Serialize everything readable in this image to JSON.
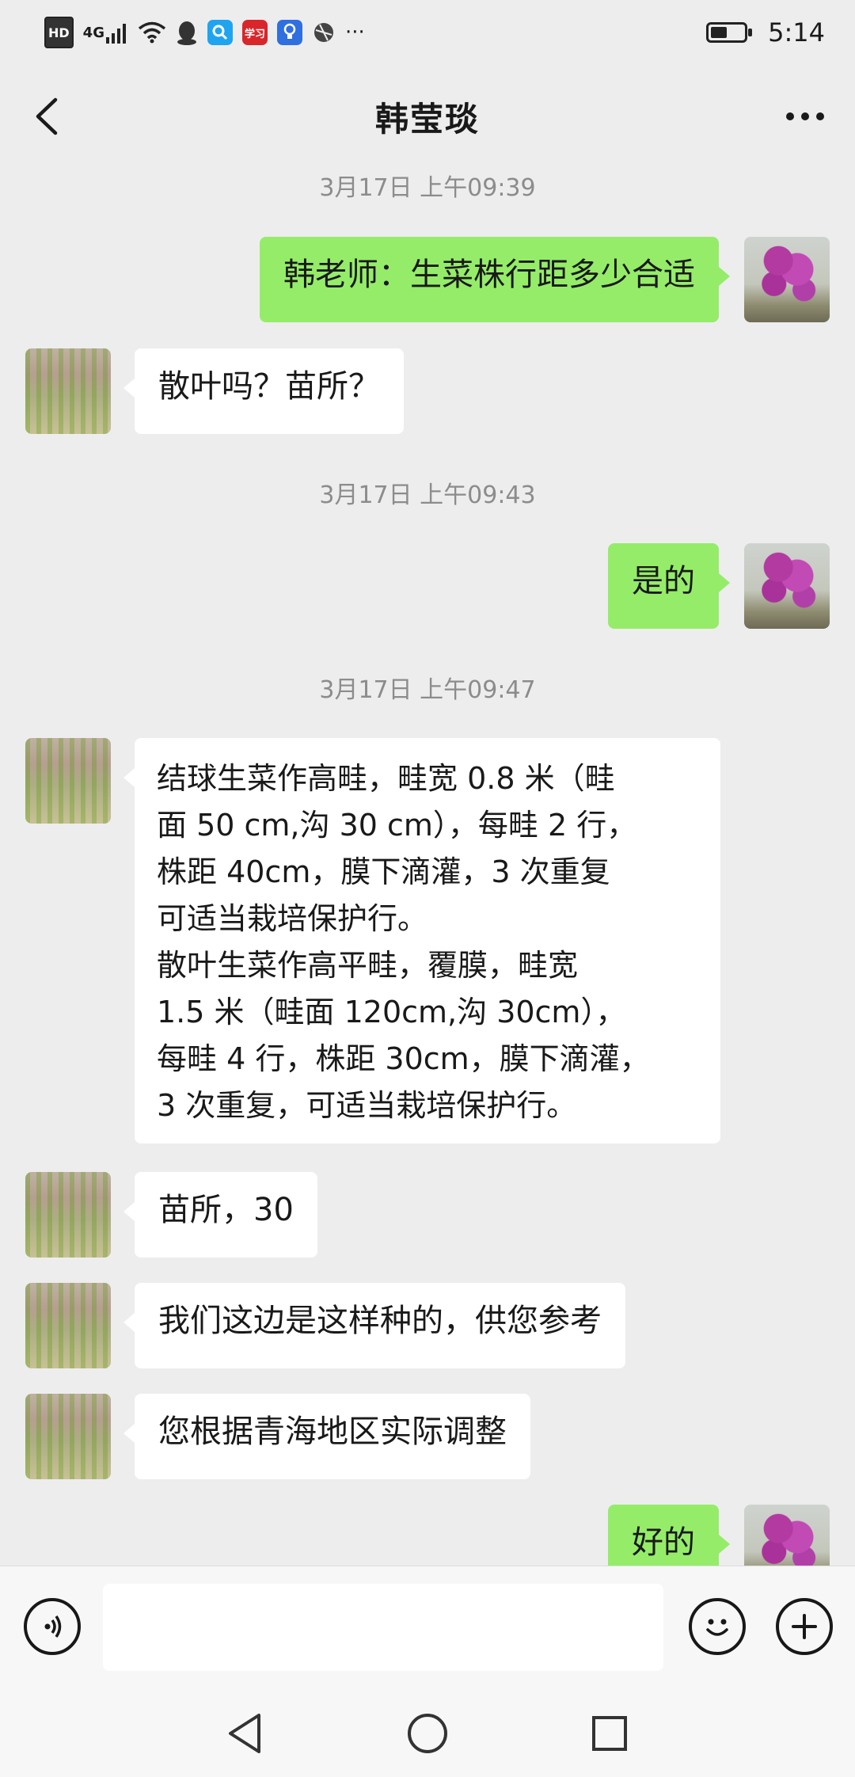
{
  "status_bar": {
    "hd": "HD",
    "network": "4G",
    "app_xuexi": "学习",
    "more": "···",
    "time": "5:14",
    "battery_level": 0.5
  },
  "header": {
    "title": "韩莹琰"
  },
  "timestamps": [
    "3月17日 上午09:39",
    "3月17日 上午09:43",
    "3月17日 上午09:47"
  ],
  "messages": [
    {
      "side": "out",
      "lines": [
        "韩老师：生菜株行距多少合适"
      ]
    },
    {
      "side": "in",
      "lines": [
        "散叶吗？苗所？"
      ]
    },
    {
      "side": "out",
      "lines": [
        "是的"
      ]
    },
    {
      "side": "in",
      "lines": [
        " 结球生菜作高畦，畦宽 0.8 米（畦",
        "面 50 cm,沟 30 cm），每畦 2 行，",
        "株距 40cm，膜下滴灌，3 次重复",
        "可适当栽培保护行。",
        "散叶生菜作高平畦，覆膜，畦宽",
        "1.5 米（畦面 120cm,沟 30cm），",
        "每畦 4 行，株距 30cm，膜下滴灌，",
        "3 次重复，可适当栽培保护行。"
      ]
    },
    {
      "side": "in",
      "lines": [
        "苗所，30"
      ]
    },
    {
      "side": "in",
      "lines": [
        "我们这边是这样种的，供您参考"
      ]
    },
    {
      "side": "in",
      "lines": [
        "您根据青海地区实际调整"
      ]
    },
    {
      "side": "out",
      "lines": [
        "好的"
      ]
    }
  ],
  "input_bar": {
    "value": "",
    "voice_icon": "voice-icon",
    "emoji_icon": "emoji-icon",
    "plus_icon": "plus-icon"
  },
  "colors": {
    "background": "#ededed",
    "outgoing_bubble": "#95ec69",
    "incoming_bubble": "#ffffff",
    "timestamp": "#8c8c8c"
  }
}
